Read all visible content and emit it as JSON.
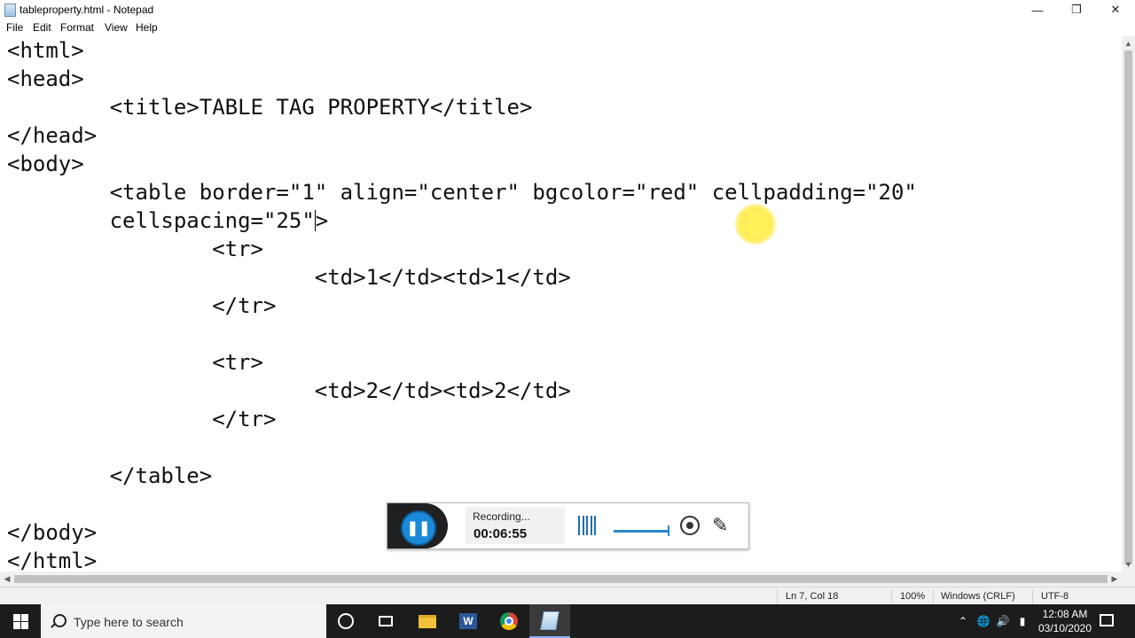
{
  "window": {
    "title": "tableproperty.html - Notepad",
    "minimize_icon": "minimize-icon",
    "maximize_icon": "restore-icon",
    "close_icon": "close-icon"
  },
  "menu": [
    "File",
    "Edit",
    "Format",
    "View",
    "Help"
  ],
  "editor": {
    "lines": [
      "<html>",
      "<head>",
      "        <title>TABLE TAG PROPERTY</title>",
      "</head>",
      "<body>",
      "        <table border=\"1\" align=\"center\" bgcolor=\"red\" cellpadding=\"20\"",
      "        cellspacing=\"25\"",
      "                <tr>",
      "                        <td>1</td><td>1</td>",
      "                </tr>",
      "",
      "                <tr>",
      "                        <td>2</td><td>2</td>",
      "                </tr>",
      "",
      "        </table>",
      "",
      "</body>",
      "</html>"
    ],
    "caret_tail": ">"
  },
  "status": {
    "position": "Ln 7, Col 18",
    "zoom": "100%",
    "line_ending": "Windows (CRLF)",
    "encoding": "UTF-8"
  },
  "recorder": {
    "status": "Recording...",
    "time": "00:06:55",
    "pause_icon": "pause-icon"
  },
  "taskbar": {
    "search_placeholder": "Type here to search",
    "clock_time": "12:08 AM",
    "clock_date": "03/10/2020"
  }
}
